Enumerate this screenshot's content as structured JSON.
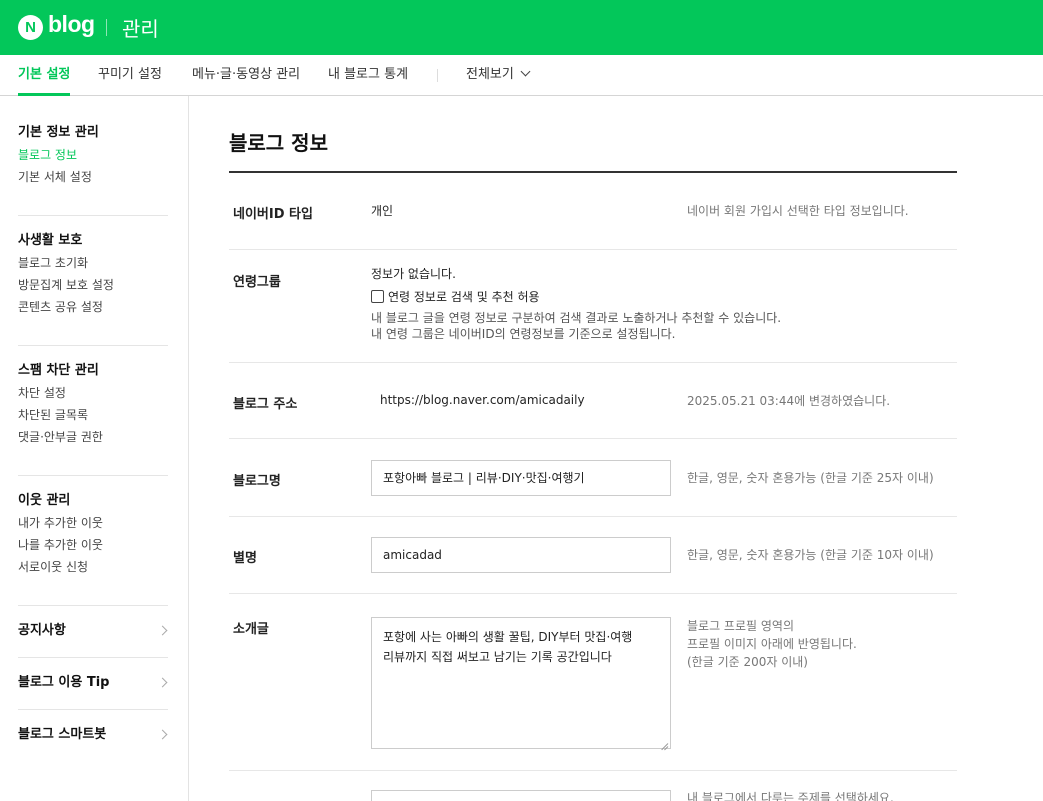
{
  "header": {
    "logo_letter": "N",
    "logo_text": "blog",
    "title": "관리",
    "brand_color": "#03c75a"
  },
  "tabs": [
    {
      "label": "기본 설정",
      "active": true
    },
    {
      "label": "꾸미기 설정",
      "active": false
    },
    {
      "label": "메뉴·글·동영상 관리",
      "active": false
    },
    {
      "label": "내 블로그 통계",
      "active": false
    },
    {
      "label": "전체보기",
      "active": false
    }
  ],
  "sidebar": {
    "groups": [
      {
        "title": "기본 정보 관리",
        "items": [
          "블로그 정보",
          "기본 서체 설정"
        ],
        "active_item": "블로그 정보"
      },
      {
        "title": "사생활 보호",
        "items": [
          "블로그 초기화",
          "방문집계 보호 설정",
          "콘텐츠 공유 설정"
        ]
      },
      {
        "title": "스팸 차단 관리",
        "items": [
          "차단 설정",
          "차단된 글목록",
          "댓글·안부글 권한"
        ]
      },
      {
        "title": "이웃 관리",
        "items": [
          "내가 추가한 이웃",
          "나를 추가한 이웃",
          "서로이웃 신청"
        ]
      }
    ],
    "links": [
      "공지사항",
      "블로그 이용 Tip",
      "블로그 스마트봇"
    ]
  },
  "main": {
    "title": "블로그 정보",
    "naver_id_type": {
      "label": "네이버ID 타입",
      "value": "개인",
      "hint": "네이버 회원 가입시 선택한 타입 정보입니다."
    },
    "age_group": {
      "label": "연령그룹",
      "value": "정보가 없습니다.",
      "checkbox_label": "연령 정보로 검색 및 추천 허용",
      "checkbox_checked": false,
      "desc1": "내 블로그 글을 연령 정보로 구분하여 검색 결과로 노출하거나 추천할 수 있습니다.",
      "desc2": "내 연령 그룹은 네이버ID의 연령정보를 기준으로 설정됩니다."
    },
    "blog_address": {
      "label": "블로그 주소",
      "value": "https://blog.naver.com/amicadaily",
      "hint": "2025.05.21 03:44에 변경하였습니다."
    },
    "blog_name": {
      "label": "블로그명",
      "value": "포항아빠 블로그 | 리뷰·DIY·맛집·여행기",
      "hint": "한글, 영문, 숫자 혼용가능 (한글 기준 25자 이내)"
    },
    "nickname": {
      "label": "별명",
      "value": "amicadad",
      "hint": "한글, 영문, 숫자 혼용가능 (한글 기준 10자 이내)"
    },
    "intro": {
      "label": "소개글",
      "value_line1": "포항에 사는 아빠의 생활 꿀팁, DIY부터 맛집·여행",
      "value_line2": "리뷰까지 직접 써보고 남기는 기록 공간입니다",
      "hint1": "블로그 프로필 영역의",
      "hint2": "프로필 이미지 아래에 반영됩니다.",
      "hint3": "(한글 기준 200자 이내)"
    },
    "topic": {
      "hint": "내 블로그에서 다루는 주제를 선택하세요."
    }
  }
}
